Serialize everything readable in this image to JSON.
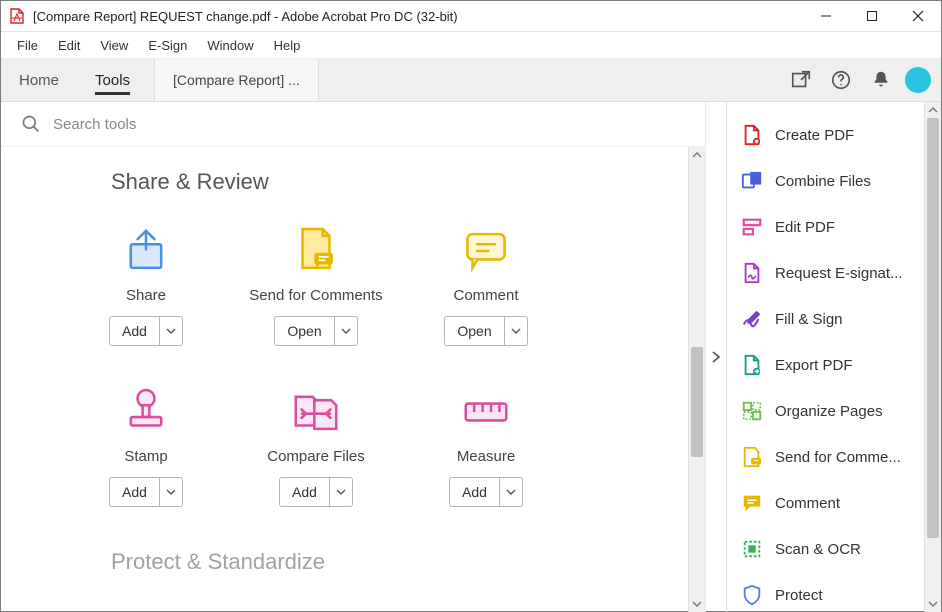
{
  "titlebar": {
    "title": "[Compare Report] REQUEST change.pdf - Adobe Acrobat Pro DC (32-bit)"
  },
  "menubar": {
    "items": [
      "File",
      "Edit",
      "View",
      "E-Sign",
      "Window",
      "Help"
    ]
  },
  "toolbar": {
    "tabs": {
      "home": "Home",
      "tools": "Tools"
    },
    "doc_tab": "[Compare Report] ..."
  },
  "search": {
    "placeholder": "Search tools"
  },
  "sections": {
    "share_review": {
      "title": "Share & Review",
      "tools": [
        {
          "name": "Share",
          "action": "Add"
        },
        {
          "name": "Send for Comments",
          "action": "Open"
        },
        {
          "name": "Comment",
          "action": "Open"
        },
        {
          "name": "Stamp",
          "action": "Add"
        },
        {
          "name": "Compare Files",
          "action": "Add"
        },
        {
          "name": "Measure",
          "action": "Add"
        }
      ]
    },
    "protect": {
      "title": "Protect & Standardize"
    }
  },
  "rightpanel": {
    "items": [
      {
        "label": "Create PDF"
      },
      {
        "label": "Combine Files"
      },
      {
        "label": "Edit PDF"
      },
      {
        "label": "Request E-signat..."
      },
      {
        "label": "Fill & Sign"
      },
      {
        "label": "Export PDF"
      },
      {
        "label": "Organize Pages"
      },
      {
        "label": "Send for Comme..."
      },
      {
        "label": "Comment"
      },
      {
        "label": "Scan & OCR"
      },
      {
        "label": "Protect"
      }
    ]
  }
}
